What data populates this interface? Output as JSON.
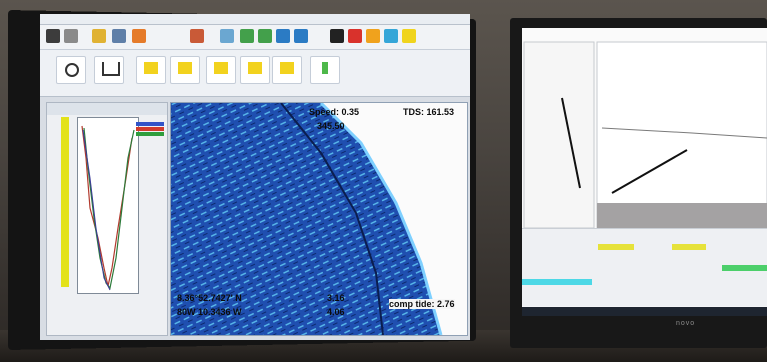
{
  "monitor_left": {
    "sonar": {
      "speed": "Speed: 0.35",
      "tds": "TDS: 161.53",
      "heading": "345.50",
      "lat": "8.36°52.7427' N",
      "lon": "80W 10.3436 W",
      "depth_a": "3.16",
      "depth_b": "4.06",
      "comp_tide": "comp tide: 2.76"
    },
    "colors": {
      "sonar_blue": "#1f4fb0",
      "sonar_light": "#56b4e8",
      "ribbon_yellow": "#f2d21e"
    }
  },
  "monitor_right": {
    "colors": {
      "status_yellow": "#e6e23a",
      "status_cyan": "#4dd8e6",
      "status_green": "#4ccf6a"
    }
  },
  "brand": {
    "logo": "novo"
  }
}
